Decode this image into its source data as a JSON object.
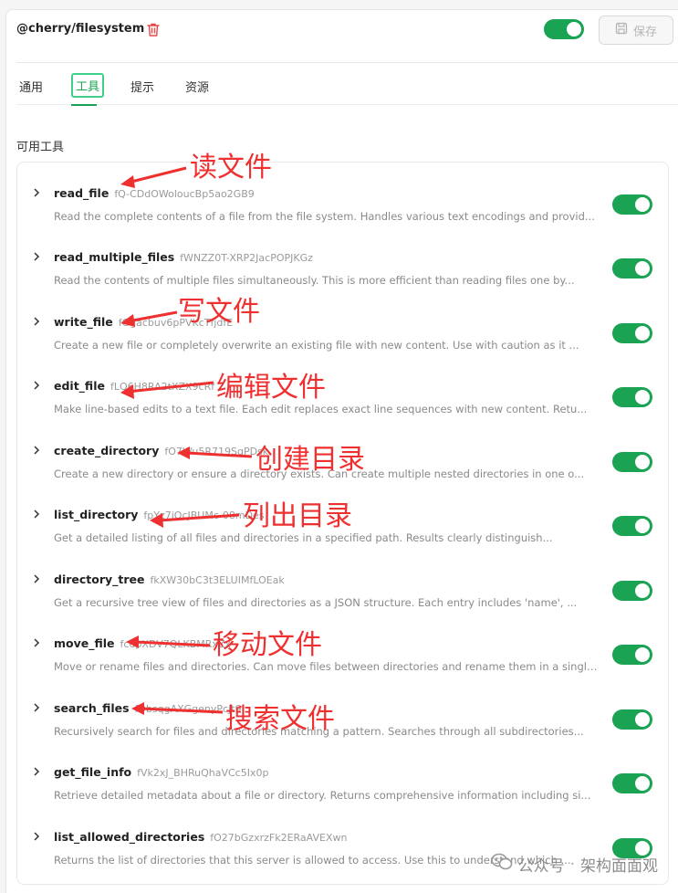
{
  "header": {
    "server_name": "@cherry/filesystem",
    "save_label": "保存",
    "enabled": true
  },
  "tabs": [
    {
      "label": "通用",
      "active": false
    },
    {
      "label": "工具",
      "active": true
    },
    {
      "label": "提示",
      "active": false
    },
    {
      "label": "资源",
      "active": false
    }
  ],
  "section_title": "可用工具",
  "tools": [
    {
      "name": "read_file",
      "id": "fQ-CDdOWoloucBp5ao2GB9",
      "desc": "Read the complete contents of a file from the file system. Handles various text encodings and provid...",
      "enabled": true
    },
    {
      "name": "read_multiple_files",
      "id": "fWNZZ0T-XRP2JacPOPJKGz",
      "desc": "Read the contents of multiple files simultaneously. This is more efficient than reading files one by...",
      "enabled": true
    },
    {
      "name": "write_file",
      "id": "fGgacbuv6pPVKcTfjdfE",
      "desc": "Create a new file or completely overwrite an existing file with new content. Use with caution as it ...",
      "enabled": true
    },
    {
      "name": "edit_file",
      "id": "fLQ6H8RA2tXZX9cRf",
      "desc": "Make line-based edits to a text file. Each edit replaces exact line sequences with new content. Retu...",
      "enabled": true
    },
    {
      "name": "create_directory",
      "id": "fO7Wu5R719SqPDsk",
      "desc": "Create a new directory or ensure a directory exists. Can create multiple nested directories in one o...",
      "enabled": true
    },
    {
      "name": "list_directory",
      "id": "fpYz7jOcJBUMc-08mDes",
      "desc": "Get a detailed listing of all files and directories in a specified path. Results clearly distinguish...",
      "enabled": true
    },
    {
      "name": "directory_tree",
      "id": "fkXW30bC3t3ELUIMfLOEak",
      "desc": "Get a recursive tree view of files and directories as a JSON structure. Each entry includes 'name', ...",
      "enabled": true
    },
    {
      "name": "move_file",
      "id": "fcdpXDV7QLKBMRxZx",
      "desc": "Move or rename files and directories. Can move files between directories and rename them in a single...",
      "enabled": true
    },
    {
      "name": "search_files",
      "id": "fDbsqgAXGgenyPcJt9",
      "desc": "Recursively search for files and directories matching a pattern. Searches through all subdirectories...",
      "enabled": true
    },
    {
      "name": "get_file_info",
      "id": "fVk2xJ_BHRuQhaVCc5Ix0p",
      "desc": "Retrieve detailed metadata about a file or directory. Returns comprehensive information including si...",
      "enabled": true
    },
    {
      "name": "list_allowed_directories",
      "id": "fO27bGzxrzFk2ERaAVEXwn",
      "desc": "Returns the list of directories that this server is allowed to access. Use this to understand which ...",
      "enabled": true
    }
  ],
  "annotations": [
    "读文件",
    "写文件",
    "编辑文件",
    "创建目录",
    "列出目录",
    "移动文件",
    "搜索文件"
  ],
  "watermark": {
    "left": "公众号",
    "right": "架构面面观"
  },
  "colors": {
    "accent": "#1aa352",
    "annotation": "#ee3030"
  }
}
